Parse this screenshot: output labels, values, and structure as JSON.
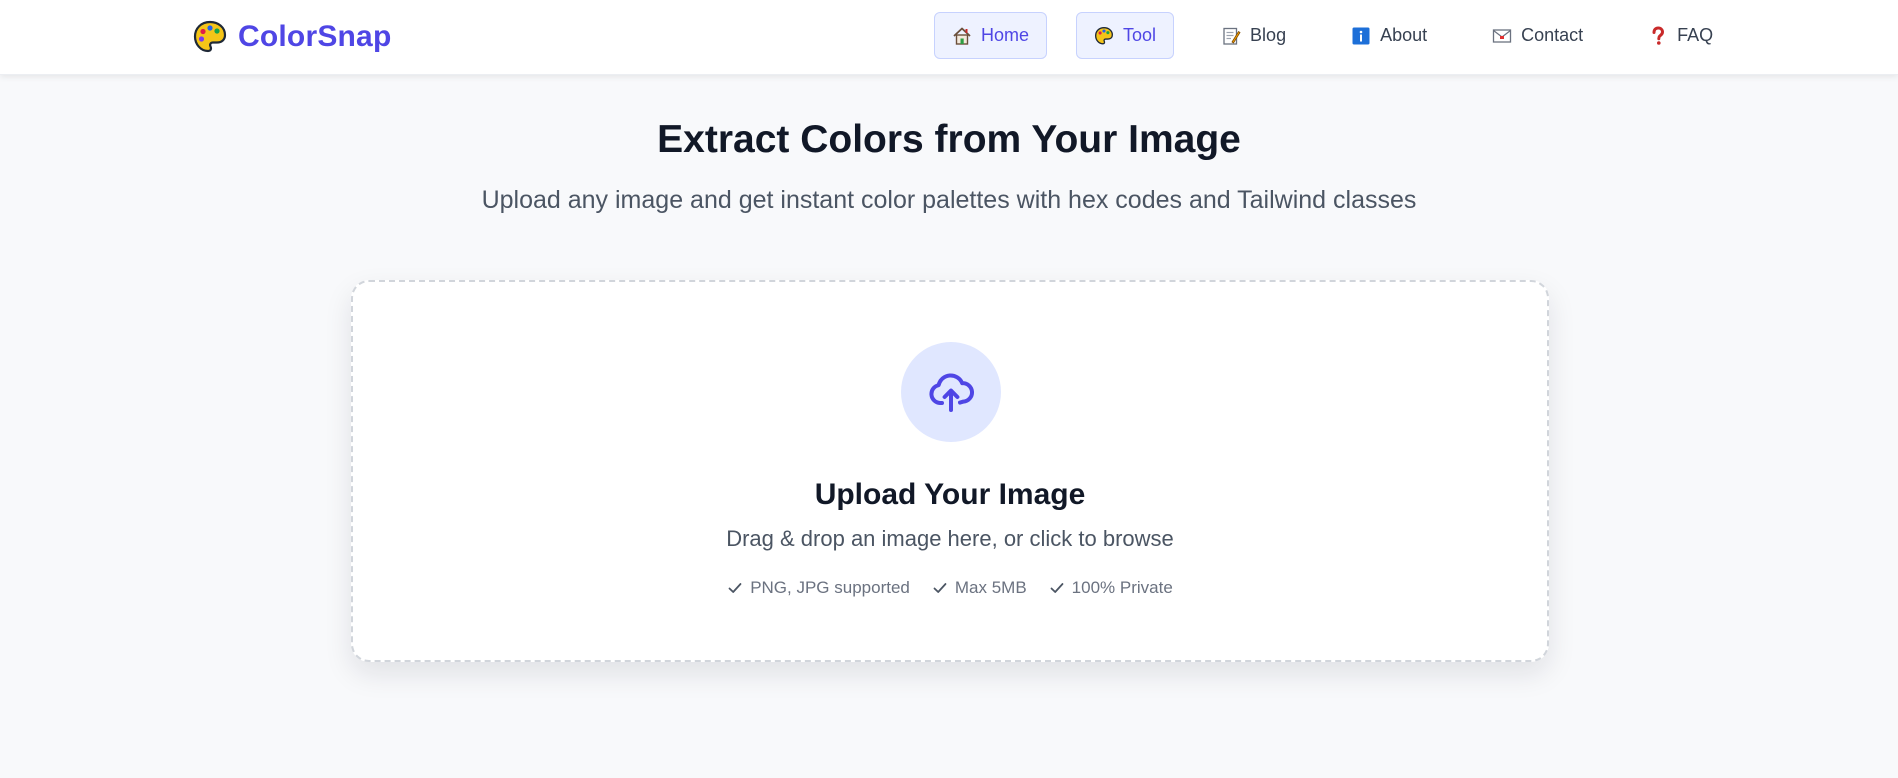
{
  "brand": {
    "name": "ColorSnap",
    "logo_icon": "palette-icon",
    "color": "#4f46e5"
  },
  "nav": {
    "items": [
      {
        "label": "Home",
        "icon": "house-icon",
        "active": true
      },
      {
        "label": "Tool",
        "icon": "palette-icon",
        "active": true
      },
      {
        "label": "Blog",
        "icon": "memo-icon",
        "active": false
      },
      {
        "label": "About",
        "icon": "info-icon",
        "active": false
      },
      {
        "label": "Contact",
        "icon": "envelope-icon",
        "active": false
      },
      {
        "label": "FAQ",
        "icon": "question-mark-icon",
        "active": false
      }
    ]
  },
  "hero": {
    "title": "Extract Colors from Your Image",
    "subtitle": "Upload any image and get instant color palettes with hex codes and Tailwind classes"
  },
  "upload": {
    "icon": "cloud-upload-icon",
    "title": "Upload Your Image",
    "description": "Drag & drop an image here, or click to browse",
    "features": [
      "PNG, JPG supported",
      "Max 5MB",
      "100% Private"
    ]
  },
  "colors": {
    "accent": "#4f46e5",
    "accent_soft": "#e0e7ff",
    "background": "#f8f9fb"
  }
}
